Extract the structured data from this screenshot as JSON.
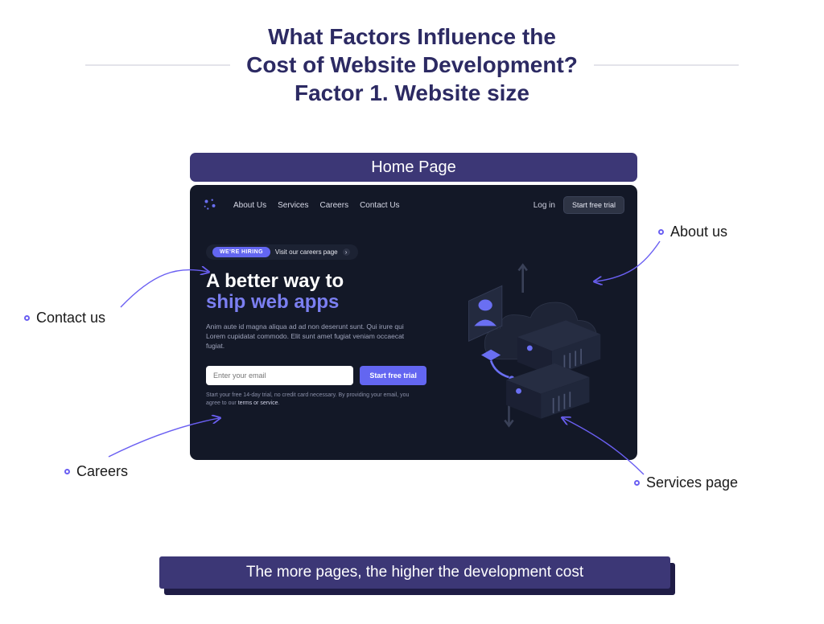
{
  "title_line1": "What Factors Influence the",
  "title_line2": "Cost of Website Development?",
  "title_line3": "Factor 1. Website size",
  "home_page_label": "Home Page",
  "mockup": {
    "nav": {
      "about": "About Us",
      "services": "Services",
      "careers": "Careers",
      "contact": "Contact Us"
    },
    "login": "Log in",
    "start_trial": "Start free trial",
    "hiring_badge": "WE'RE HIRING",
    "hiring_link": "Visit our careers page",
    "hero_h1": "A better way to",
    "hero_h2": "ship web apps",
    "hero_p": "Anim aute id magna aliqua ad ad non deserunt sunt. Qui irure qui Lorem cupidatat commodo. Elit sunt amet fugiat veniam occaecat fugiat.",
    "email_placeholder": "Enter your email",
    "cta": "Start free trial",
    "disclaimer_a": "Start your free 14-day trial, no credit card necessary. By providing your email, you agree to our ",
    "disclaimer_b": "terms or service",
    "disclaimer_c": "."
  },
  "annotations": {
    "contact": "Contact us",
    "careers": "Careers",
    "about": "About us",
    "services": "Services page"
  },
  "footer": "The more pages, the higher the development cost"
}
